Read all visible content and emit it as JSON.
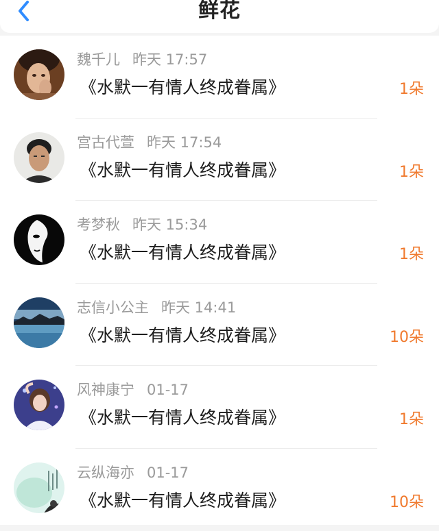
{
  "header": {
    "title": "鲜花",
    "back_icon": "chevron-left-icon",
    "accent_color": "#2f8cff"
  },
  "colors": {
    "count": "#f07a2e",
    "meta": "#9a9a9a"
  },
  "gifts": [
    {
      "name": "魏千儿",
      "time": "昨天 17:57",
      "book": "《水默一有情人终成眷属》",
      "count": "1朵"
    },
    {
      "name": "宫古代萱",
      "time": "昨天 17:54",
      "book": "《水默一有情人终成眷属》",
      "count": "1朵"
    },
    {
      "name": "考梦秋",
      "time": "昨天 15:34",
      "book": "《水默一有情人终成眷属》",
      "count": "1朵"
    },
    {
      "name": "志信小公主",
      "time": "昨天 14:41",
      "book": "《水默一有情人终成眷属》",
      "count": "10朵"
    },
    {
      "name": "风神康宁",
      "time": "01-17",
      "book": "《水默一有情人终成眷属》",
      "count": "1朵"
    },
    {
      "name": "云纵海亦",
      "time": "01-17",
      "book": "《水默一有情人终成眷属》",
      "count": "10朵"
    }
  ]
}
